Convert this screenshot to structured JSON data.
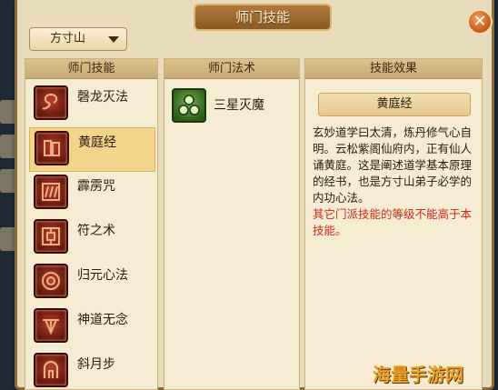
{
  "window": {
    "title": "师门技能",
    "close_label": "✕"
  },
  "school_select": {
    "value": "方寸山"
  },
  "skills_panel": {
    "header": "师门技能",
    "items": [
      {
        "label": "磬龙灭法",
        "icon": "dragon-icon",
        "selected": false
      },
      {
        "label": "黄庭经",
        "icon": "scroll-icon",
        "selected": true
      },
      {
        "label": "霹雳咒",
        "icon": "thunder-icon",
        "selected": false
      },
      {
        "label": "符之术",
        "icon": "talisman-icon",
        "selected": false
      },
      {
        "label": "归元心法",
        "icon": "spiral-icon",
        "selected": false
      },
      {
        "label": "神道无念",
        "icon": "shrine-icon",
        "selected": false
      },
      {
        "label": "斜月步",
        "icon": "arch-icon",
        "selected": false
      }
    ]
  },
  "spells_panel": {
    "header": "师门法术",
    "items": [
      {
        "label": "三星灭魔",
        "icon": "three-stars-icon"
      }
    ]
  },
  "effect_panel": {
    "header": "技能效果",
    "skill_name": "黄庭经",
    "description": "玄妙道学曰太清，炼丹修气心自明。云松紫阁仙府内，正有仙人诵黄庭。这是阐述道学基本原理的经书，也是方寸山弟子必学的内功心法。",
    "warning": "其它门派技能的等级不能高于本技能。"
  },
  "watermark": "海量手游网",
  "colors": {
    "warning": "#d22a14",
    "selected_row": "#f2d58a",
    "title_bar": "#8a5a22"
  }
}
